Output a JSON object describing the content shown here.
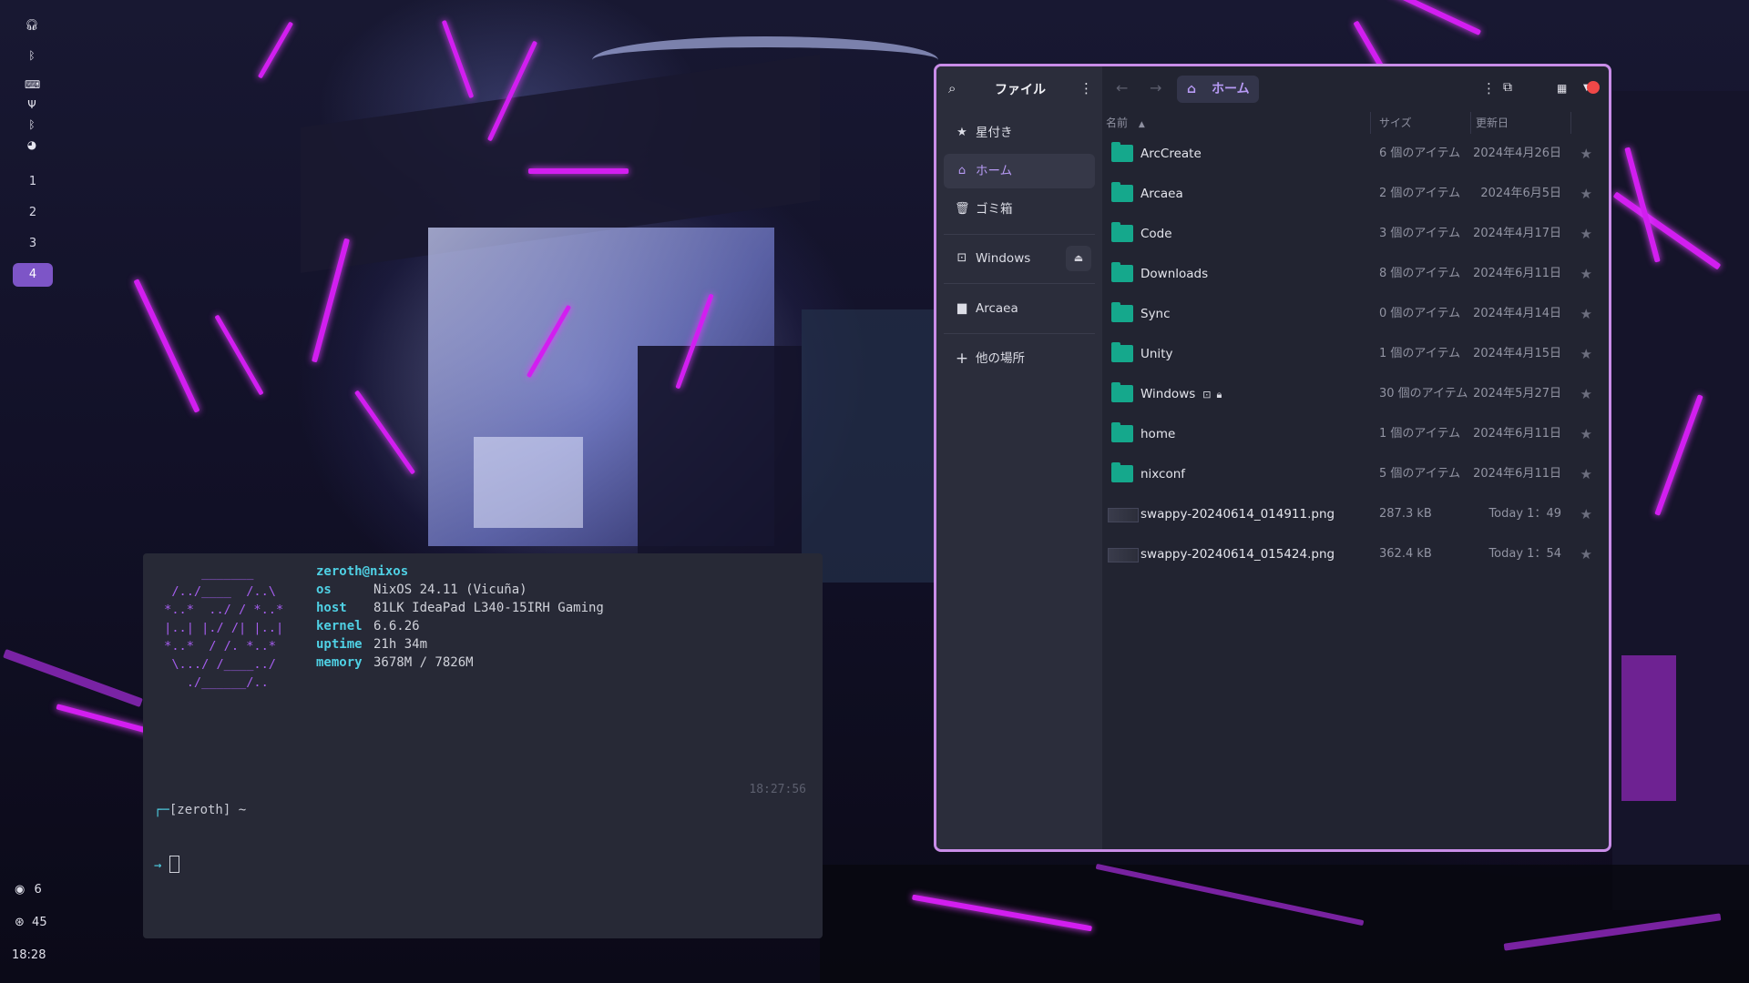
{
  "bar": {
    "top_icons": [
      "headphones-icon",
      "bluetooth-icon",
      "keyboard-icon",
      "usb-icon",
      "bluetooth-icon",
      "steam-icon"
    ],
    "workspaces": [
      "1",
      "2",
      "3",
      "4"
    ],
    "active_workspace": "4",
    "stats": [
      {
        "icon": "discord-icon",
        "value": "6"
      },
      {
        "icon": "network-icon",
        "value": "45"
      }
    ],
    "clock": "18:28"
  },
  "terminal": {
    "user_host": "zeroth@nixos",
    "info": [
      {
        "key": "os",
        "value": "NixOS 24.11 (Vicuña)"
      },
      {
        "key": "host",
        "value": "81LK IdeaPad L340-15IRH Gaming"
      },
      {
        "key": "kernel",
        "value": "6.6.26"
      },
      {
        "key": "uptime",
        "value": "21h 34m"
      },
      {
        "key": "memory",
        "value": "3678M / 7826M"
      }
    ],
    "prompt": "[zeroth] ~",
    "prompt_arrow": "→",
    "time": "18:27:56"
  },
  "files": {
    "app_title": "ファイル",
    "path": "ホーム",
    "places": [
      {
        "icon": "star-icon",
        "label": "星付き"
      },
      {
        "icon": "home-icon",
        "label": "ホーム",
        "active": true
      },
      {
        "icon": "trash-icon",
        "label": "ゴミ箱"
      },
      {
        "icon": "drive-icon",
        "label": "Windows",
        "eject": true
      },
      {
        "icon": "folder-icon",
        "label": "Arcaea"
      },
      {
        "icon": "plus-icon",
        "label": "他の場所"
      }
    ],
    "columns": {
      "name": "名前",
      "size": "サイズ",
      "modified": "更新日"
    },
    "rows": [
      {
        "type": "folder",
        "name": "ArcCreate",
        "size": "6 個のアイテム",
        "date": "2024年4月26日"
      },
      {
        "type": "folder",
        "name": "Arcaea",
        "size": "2 個のアイテム",
        "date": "2024年6月5日"
      },
      {
        "type": "folder",
        "name": "Code",
        "size": "3 個のアイテム",
        "date": "2024年4月17日"
      },
      {
        "type": "folder",
        "name": "Downloads",
        "size": "8 個のアイテム",
        "date": "2024年6月11日"
      },
      {
        "type": "folder",
        "name": "Sync",
        "size": "0 個のアイテム",
        "date": "2024年4月14日"
      },
      {
        "type": "folder",
        "name": "Unity",
        "size": "1 個のアイテム",
        "date": "2024年4月15日"
      },
      {
        "type": "folder",
        "name": "Windows",
        "size": "30 個のアイテム",
        "date": "2024年5月27日",
        "emblems": [
          "drive-icon",
          "lock-icon"
        ]
      },
      {
        "type": "folder",
        "name": "home",
        "size": "1 個のアイテム",
        "date": "2024年6月11日"
      },
      {
        "type": "folder",
        "name": "nixconf",
        "size": "5 個のアイテム",
        "date": "2024年6月11日"
      },
      {
        "type": "image",
        "name": "swappy-20240614_014911.png",
        "size": "287.3 kB",
        "date": "Today 1：49"
      },
      {
        "type": "image",
        "name": "swappy-20240614_015424.png",
        "size": "362.4 kB",
        "date": "Today 1：54"
      }
    ]
  }
}
